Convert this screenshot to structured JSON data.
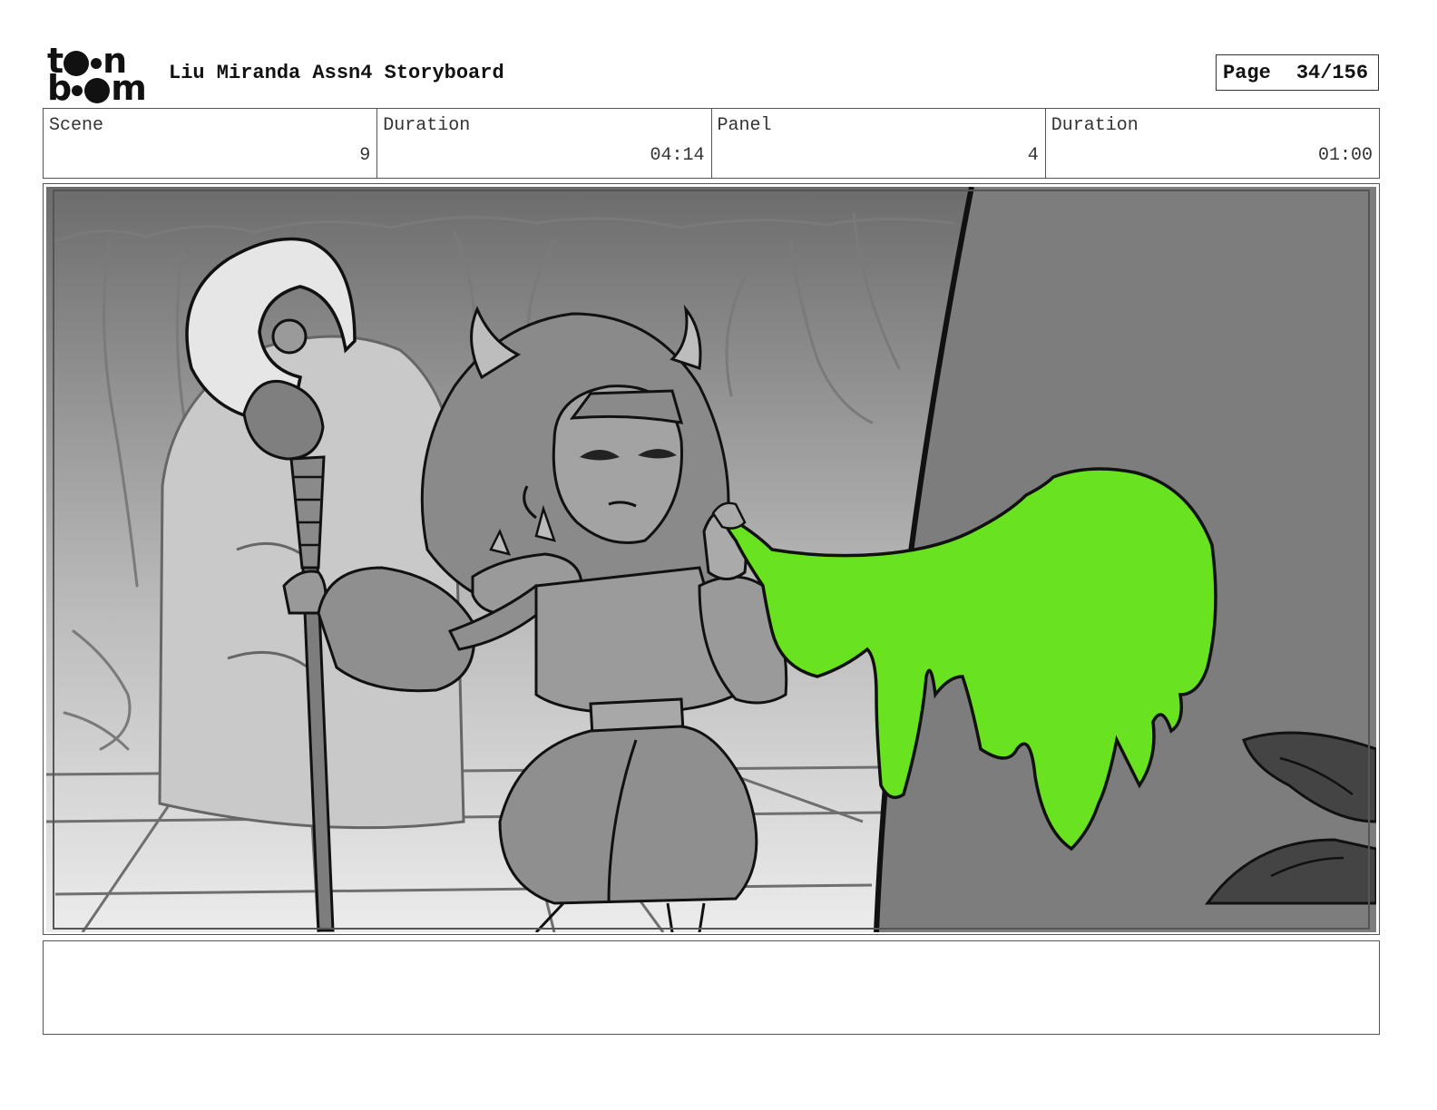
{
  "header": {
    "logo": {
      "line1": "toon",
      "line2": "boom"
    },
    "title": "Liu Miranda Assn4 Storyboard",
    "page_label": "Page",
    "page_value": "34/156"
  },
  "info": [
    {
      "label": "Scene",
      "value": "9"
    },
    {
      "label": "Duration",
      "value": "04:14"
    },
    {
      "label": "Panel",
      "value": "4"
    },
    {
      "label": "Duration",
      "value": "01:00"
    }
  ],
  "panel": {
    "colors": {
      "slime": "#69e31f",
      "wall_dark": "#7d7d7d",
      "line": "#111111"
    }
  },
  "notes": {
    "text": ""
  }
}
